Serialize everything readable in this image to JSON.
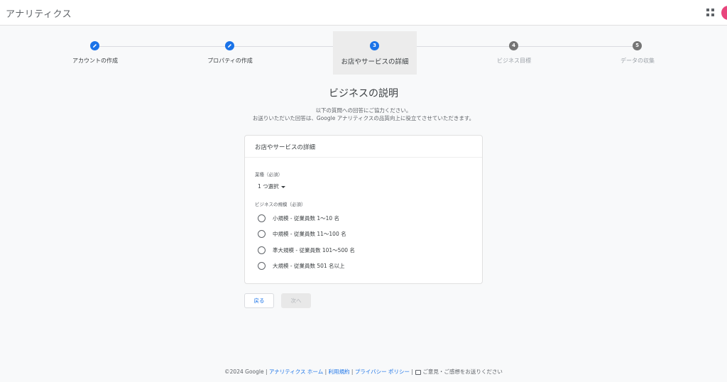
{
  "header": {
    "title": "アナリティクス",
    "apps_icon": "apps-grid-icon"
  },
  "stepper": {
    "steps": [
      {
        "number": "1",
        "label": "アカウントの作成",
        "state": "done"
      },
      {
        "number": "2",
        "label": "プロパティの作成",
        "state": "done"
      },
      {
        "number": "3",
        "label": "お店やサービスの詳細",
        "state": "current"
      },
      {
        "number": "4",
        "label": "ビジネス目標",
        "state": "pending"
      },
      {
        "number": "5",
        "label": "データの収集",
        "state": "pending"
      }
    ]
  },
  "main": {
    "heading": "ビジネスの説明",
    "subtext_1": "以下の質問への回答にご協力ください。",
    "subtext_2": "お送りいただいた回答は、Google アナリティクスの品質向上に役立てさせていただきます。"
  },
  "card": {
    "title": "お店やサービスの詳細",
    "industry_label": "業種（必須）",
    "industry_value": "1 つ選択",
    "size_label": "ビジネスの規模（必須）",
    "size_options": [
      "小規模 - 従業員数 1～10 名",
      "中規模 - 従業員数 11～100 名",
      "準大規模 - 従業員数 101～500 名",
      "大規模 - 従業員数 501 名以上"
    ]
  },
  "actions": {
    "back_label": "戻る",
    "next_label": "次へ"
  },
  "footer": {
    "copyright": "©2024 Google",
    "sep": " | ",
    "link_home": "アナリティクス ホーム",
    "link_terms": "利用規約",
    "link_privacy": "プライバシー ポリシー",
    "feedback": "ご意見・ご感想をお送りください"
  },
  "colors": {
    "accent": "#1a73e8",
    "pending": "#757575",
    "avatar": "#e8457c"
  }
}
